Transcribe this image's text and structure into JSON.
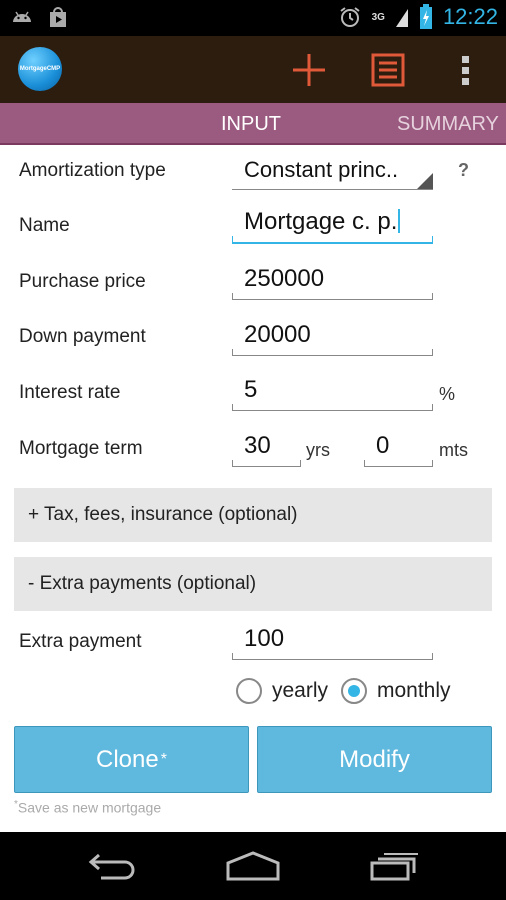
{
  "status_bar": {
    "time": "12:22",
    "network": "3G",
    "icons": [
      "android-icon",
      "play-store-icon",
      "alarm-icon",
      "signal-icon",
      "battery-icon"
    ]
  },
  "app": {
    "logo_text": "MortgageCMP",
    "actions": [
      "add-icon",
      "list-icon",
      "overflow-menu-icon"
    ],
    "accent": "#33b5e5",
    "action_color": "#e05a3a"
  },
  "tabs": [
    {
      "label": "INPUT",
      "active": true
    },
    {
      "label": "SUMMARY",
      "active": false
    }
  ],
  "form": {
    "amortization_type": {
      "label": "Amortization type",
      "value": "Constant princ.."
    },
    "help": "?",
    "name": {
      "label": "Name",
      "value": "Mortgage c. p."
    },
    "purchase_price": {
      "label": "Purchase price",
      "value": "250000"
    },
    "down_payment": {
      "label": "Down payment",
      "value": "20000"
    },
    "interest_rate": {
      "label": "Interest rate",
      "value": "5",
      "unit": "%"
    },
    "mortgage_term": {
      "label": "Mortgage term",
      "years": "30",
      "years_unit": "yrs",
      "months": "0",
      "months_unit": "mts"
    },
    "tax_section": "+ Tax, fees, insurance (optional)",
    "extra_section": "- Extra payments (optional)",
    "extra_payment": {
      "label": "Extra payment",
      "value": "100"
    },
    "frequency": {
      "options": [
        "yearly",
        "monthly"
      ],
      "selected": "monthly"
    }
  },
  "buttons": {
    "clone": "Clone",
    "clone_mark": "*",
    "modify": "Modify"
  },
  "footnote": {
    "mark": "*",
    "text": "Save as new mortgage"
  }
}
